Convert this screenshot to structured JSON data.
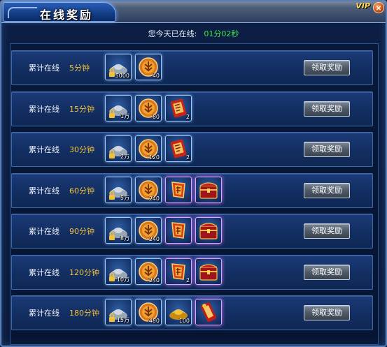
{
  "window": {
    "title": "在线奖励",
    "vip_badge": "VIP",
    "close_glyph": "×"
  },
  "status": {
    "label": "您今天已在线:",
    "time": "01分02秒"
  },
  "claim_label": "领取奖励",
  "row_label": "累计在线",
  "rows": [
    {
      "minutes": "5分钟",
      "rewards": [
        {
          "icon": "silver-ingot-icon",
          "qty": "5000",
          "locked": true
        },
        {
          "icon": "gold-coin-icon",
          "qty": "40"
        }
      ]
    },
    {
      "minutes": "15分钟",
      "rewards": [
        {
          "icon": "silver-ingot-icon",
          "qty": "1万",
          "locked": true
        },
        {
          "icon": "gold-coin-icon",
          "qty": "80"
        },
        {
          "icon": "scroll-icon",
          "qty": "2"
        }
      ]
    },
    {
      "minutes": "30分钟",
      "rewards": [
        {
          "icon": "silver-ingot-icon",
          "qty": "2万",
          "locked": true
        },
        {
          "icon": "gold-coin-icon",
          "qty": "120"
        },
        {
          "icon": "scroll-icon",
          "qty": "2"
        }
      ]
    },
    {
      "minutes": "60分钟",
      "rewards": [
        {
          "icon": "silver-ingot-icon",
          "qty": "5万",
          "locked": true
        },
        {
          "icon": "gold-coin-icon",
          "qty": "240"
        },
        {
          "icon": "talisman-icon",
          "qty": "",
          "purple": true
        },
        {
          "icon": "treasure-chest-icon",
          "qty": "",
          "purple": true
        }
      ]
    },
    {
      "minutes": "90分钟",
      "rewards": [
        {
          "icon": "silver-ingot-icon",
          "qty": "8万",
          "locked": true
        },
        {
          "icon": "gold-coin-icon",
          "qty": "240"
        },
        {
          "icon": "talisman-icon",
          "qty": "",
          "purple": true
        },
        {
          "icon": "treasure-chest-icon",
          "qty": "",
          "purple": true
        }
      ]
    },
    {
      "minutes": "120分钟",
      "rewards": [
        {
          "icon": "silver-ingot-icon",
          "qty": "10万",
          "locked": true
        },
        {
          "icon": "gold-coin-icon",
          "qty": "240"
        },
        {
          "icon": "talisman-icon",
          "qty": "2",
          "purple": true
        },
        {
          "icon": "treasure-chest-icon",
          "qty": "",
          "purple": true
        }
      ]
    },
    {
      "minutes": "180分钟",
      "rewards": [
        {
          "icon": "silver-ingot-icon",
          "qty": "15万",
          "locked": true
        },
        {
          "icon": "gold-coin-icon",
          "qty": "480"
        },
        {
          "icon": "gold-ingot-icon",
          "qty": "100"
        },
        {
          "icon": "red-scroll-icon",
          "qty": "",
          "purple": true
        }
      ]
    }
  ]
}
